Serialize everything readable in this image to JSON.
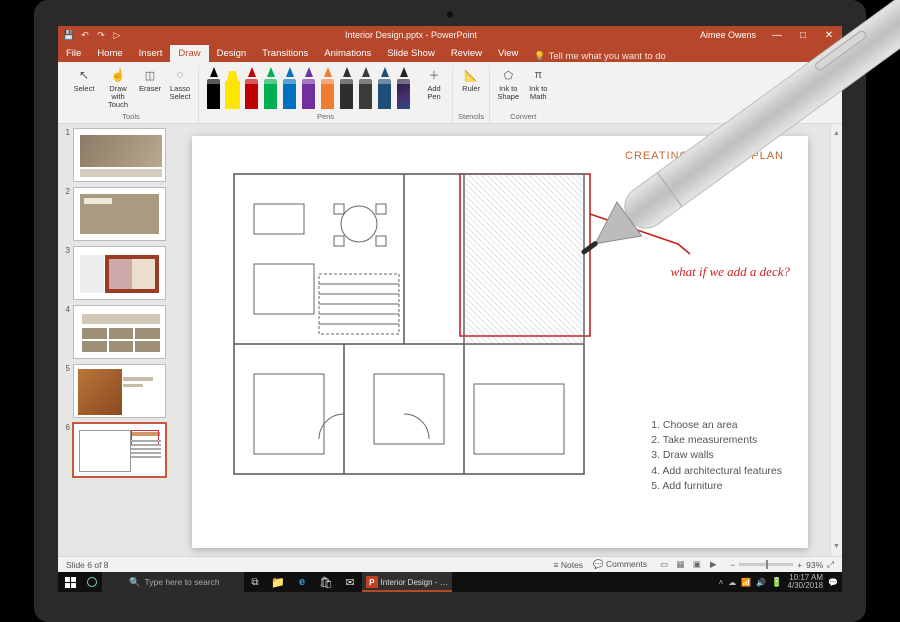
{
  "title": {
    "document": "Interior Design.pptx",
    "app": "PowerPoint",
    "combined": "Interior Design.pptx - PowerPoint"
  },
  "user": "Aimee Owens",
  "qat": {
    "save": "💾",
    "undo": "↶",
    "redo": "↷",
    "start": "▷"
  },
  "winbtns": {
    "min": "—",
    "max": "□",
    "close": "✕"
  },
  "tabs": [
    "File",
    "Home",
    "Insert",
    "Draw",
    "Design",
    "Transitions",
    "Animations",
    "Slide Show",
    "Review",
    "View"
  ],
  "active_tab": "Draw",
  "tellme": "Tell me what you want to do",
  "ribbon": {
    "tools": {
      "label": "Tools",
      "select": "Select",
      "drawtouch": "Draw with Touch",
      "eraser": "Eraser",
      "lasso": "Lasso Select"
    },
    "pens": {
      "label": "Pens",
      "items": [
        {
          "type": "pen",
          "color": "#000000"
        },
        {
          "type": "hiliter",
          "color": "#FFE600"
        },
        {
          "type": "pen",
          "color": "#C00000"
        },
        {
          "type": "pen",
          "color": "#00B050"
        },
        {
          "type": "pen",
          "color": "#0070C0"
        },
        {
          "type": "pen",
          "color": "#7030A0"
        },
        {
          "type": "pen",
          "color": "#ED7D31"
        },
        {
          "type": "pen",
          "color": "#2E2E2E"
        },
        {
          "type": "pen",
          "color": "#3B3B3B"
        },
        {
          "type": "pen",
          "color": "#1F4E79"
        },
        {
          "type": "pen",
          "color": "#222222",
          "galaxy": true
        }
      ],
      "addpen": "Add Pen"
    },
    "stencils": {
      "label": "Stencils",
      "ruler": "Ruler"
    },
    "convert": {
      "label": "Convert",
      "inktoshape": "Ink to Shape",
      "inktomath": "Ink to Math"
    }
  },
  "thumbnails": {
    "count": 8,
    "selected": 6,
    "labels": [
      "1",
      "2",
      "3",
      "4",
      "5",
      "6"
    ]
  },
  "slide": {
    "heading": "CREATING A FLOOR PLAN",
    "list": [
      "1. Choose an area",
      "2. Take measurements",
      "3. Draw walls",
      "4. Add architectural features",
      "5. Add furniture"
    ],
    "ink_annotation": "what if we add a deck?"
  },
  "statusbar": {
    "slide": "Slide 6 of 8",
    "notes": "Notes",
    "comments": "Comments",
    "zoom": "93%",
    "fit": "⤢"
  },
  "taskbar": {
    "search_placeholder": "Type here to search",
    "active_app": "Interior Design - P...",
    "time": "10:17 AM",
    "date": "4/30/2018"
  }
}
